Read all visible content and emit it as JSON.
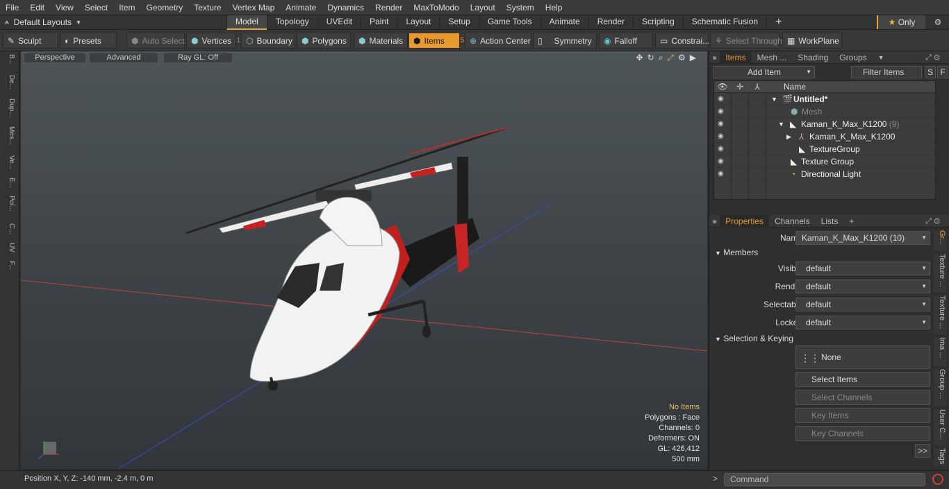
{
  "menu": [
    "File",
    "Edit",
    "View",
    "Select",
    "Item",
    "Geometry",
    "Texture",
    "Vertex Map",
    "Animate",
    "Dynamics",
    "Render",
    "MaxToModo",
    "Layout",
    "System",
    "Help"
  ],
  "layout_selector": "Default Layouts",
  "layout_tabs": [
    "Model",
    "Topology",
    "UVEdit",
    "Paint",
    "Layout",
    "Setup",
    "Game Tools",
    "Animate",
    "Render",
    "Scripting",
    "Schematic Fusion"
  ],
  "active_layout_tab": "Model",
  "only_label": "Only",
  "toolbar": {
    "sculpt": "Sculpt",
    "presets": "Presets",
    "auto_select": "Auto Select",
    "vertices": "Vertices",
    "vertices_count": "1",
    "boundary": "Boundary",
    "polygons": "Polygons",
    "materials": "Materials",
    "items": "Items",
    "items_count": "5",
    "action_center": "Action Center",
    "symmetry": "Symmetry",
    "falloff": "Falloff",
    "constraints": "Constrai...",
    "select_through": "Select Through",
    "workplane": "WorkPlane"
  },
  "left_strip": [
    "B...",
    "De...",
    "Dup...",
    "Mes...",
    "Ve...",
    "E...",
    "Pol...",
    "C...",
    "UV",
    "F..."
  ],
  "viewport": {
    "perspective": "Perspective",
    "advanced": "Advanced",
    "raygl": "Ray GL: Off",
    "stats": {
      "no_items": "No Items",
      "polygons": "Polygons : Face",
      "channels": "Channels: 0",
      "deformers": "Deformers: ON",
      "gl": "GL: 426,412",
      "scale": "500 mm"
    }
  },
  "status": "Position X, Y, Z:   -140 mm, -2.4 m, 0 m",
  "items_panel": {
    "tabs": [
      "Items",
      "Mesh ...",
      "Shading",
      "Groups"
    ],
    "add_item": "Add Item",
    "filter": "Filter Items",
    "s_btn": "S",
    "f_btn": "F",
    "name_header": "Name",
    "rows": [
      {
        "label": "Untitled*",
        "count": ""
      },
      {
        "label": "Mesh",
        "count": ""
      },
      {
        "label": "Kaman_K_Max_K1200",
        "count": "(9)"
      },
      {
        "label": "Kaman_K_Max_K1200",
        "count": ""
      },
      {
        "label": "TextureGroup",
        "count": ""
      },
      {
        "label": "Texture Group",
        "count": ""
      },
      {
        "label": "Directional Light",
        "count": ""
      }
    ]
  },
  "properties": {
    "tabs": [
      "Properties",
      "Channels",
      "Lists"
    ],
    "name_label": "Name",
    "name_value": "Kaman_K_Max_K1200 (10)",
    "members": "Members",
    "visible_label": "Visible",
    "visible_value": "default",
    "render_label": "Render",
    "render_value": "default",
    "selectable_label": "Selectable",
    "selectable_value": "default",
    "locked_label": "Locked",
    "locked_value": "default",
    "selection_keying": "Selection & Keying",
    "none": "None",
    "select_items": "Select Items",
    "select_channels": "Select Channels",
    "key_items": "Key Items",
    "key_channels": "Key Channels",
    "more": ">>"
  },
  "side_tabs": [
    "Gr...",
    "Texture ...",
    "Texture ...",
    "Ima ...",
    "Group ...",
    "User C...",
    "Tags"
  ],
  "command_placeholder": "Command"
}
